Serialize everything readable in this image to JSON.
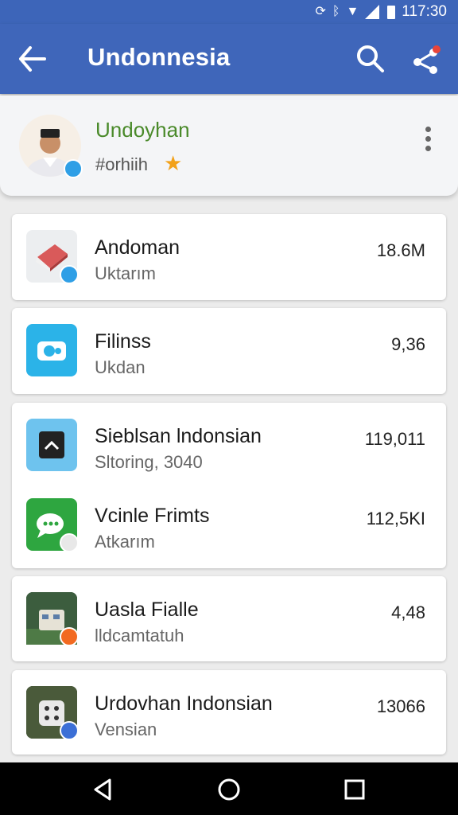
{
  "status_bar": {
    "time": "117:30"
  },
  "app_bar": {
    "title": "Undonnesia"
  },
  "profile": {
    "name": "Undoyhan",
    "handle": "#orhiih"
  },
  "items": [
    {
      "title": "Andoman",
      "subtitle": "Uktarım",
      "value": "18.6M"
    },
    {
      "title": "Filinss",
      "subtitle": "Ukdan",
      "value": "9,36"
    },
    {
      "title": "Sieblsan lndonsian",
      "subtitle": "Sltoring, 3040",
      "value": "119,011"
    },
    {
      "title": "Vcinle Frimts",
      "subtitle": "Atkarım",
      "value": "112,5KI"
    },
    {
      "title": "Uasla Fialle",
      "subtitle": "lldcamtatuh",
      "value": "4,48"
    },
    {
      "title": "Urdovhan Indonsian",
      "subtitle": "Vensian",
      "value": "13066"
    }
  ],
  "colors": {
    "app_bar": "#3f66ba",
    "profile_name": "#4a8a2a",
    "star": "#f2a11a",
    "badge_blue": "#2f9fe6",
    "badge_orange": "#f26a21",
    "icon_cyan": "#2bb3e8",
    "icon_green": "#2ea640"
  },
  "icons": {
    "back": "arrow-back-icon",
    "search": "search-icon",
    "share": "share-icon",
    "more": "more-vertical-icon",
    "star": "star-icon",
    "nav_back": "triangle-back-icon",
    "nav_home": "circle-home-icon",
    "nav_recents": "square-recents-icon"
  }
}
